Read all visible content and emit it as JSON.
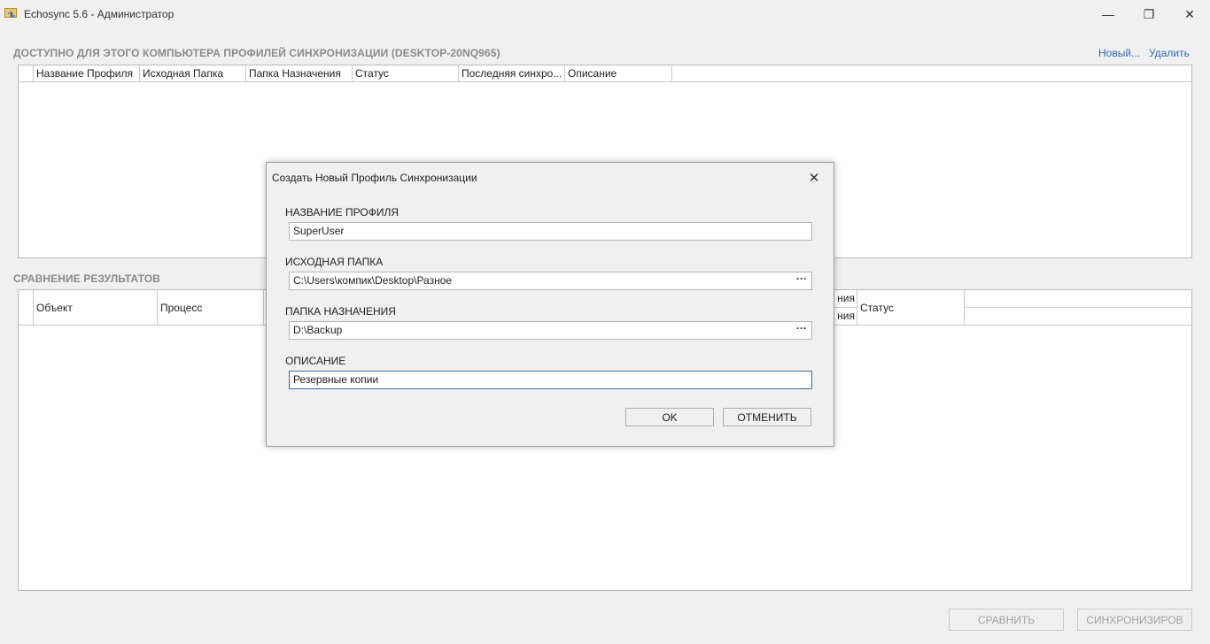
{
  "window": {
    "title": "Echosync 5.6 - Администратор",
    "minimize_glyph": "—",
    "maximize_glyph": "❐",
    "close_glyph": "✕"
  },
  "profiles": {
    "section_title": "ДОСТУПНО ДЛЯ ЭТОГО КОМПЬЮТЕРА ПРОФИЛЕЙ СИНХРОНИЗАЦИИ (DESKTOP-20NQ965)",
    "new_link": "Новый...",
    "delete_link": "Удалить",
    "columns": [
      "Название Профиля",
      "Исходная Папка",
      "Папка Назначения",
      "Статус",
      "Последняя синхро...",
      "Описание"
    ]
  },
  "comparison": {
    "section_title": "СРАВНЕНИЕ РЕЗУЛЬТАТОВ",
    "columns": [
      "Объект",
      "Процесс",
      "ния",
      "ния",
      "Статус"
    ]
  },
  "buttons": {
    "compare": "СРАВНИТЬ",
    "sync": "СИНХРОНИЗИРОВ"
  },
  "dialog": {
    "title": "Создать Новый Профиль Синхронизации",
    "close_glyph": "✕",
    "profile_name_label": "НАЗВАНИЕ ПРОФИЛЯ",
    "profile_name_value": "SuperUser",
    "source_label": "ИСХОДНАЯ ПАПКА",
    "source_value": "C:\\Users\\компик\\Desktop\\Разное",
    "dest_label": "ПАПКА НАЗНАЧЕНИЯ",
    "dest_value": "D:\\Backup",
    "description_label": "ОПИСАНИЕ",
    "description_value": "Резервные копии",
    "browse_glyph": "···",
    "ok": "OK",
    "cancel": "ОТМЕНИТЬ"
  }
}
